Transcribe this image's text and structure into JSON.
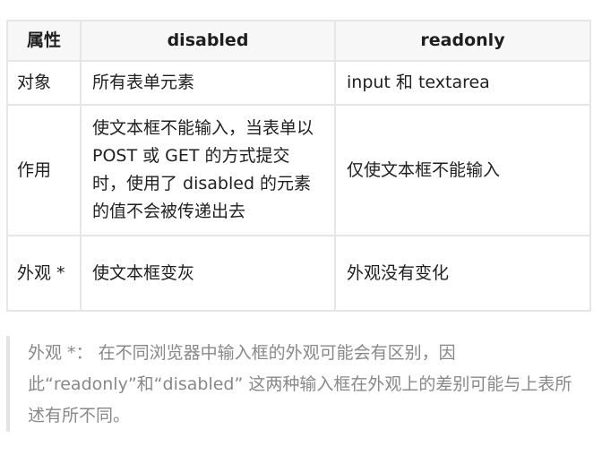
{
  "table": {
    "headers": [
      "属性",
      "disabled",
      "readonly"
    ],
    "rows": [
      {
        "label": "对象",
        "disabled": "所有表单元素",
        "readonly": "input 和 textarea"
      },
      {
        "label": "作用",
        "disabled": "使文本框不能输入，当表单以 POST 或 GET 的方式提交时，使用了 disabled 的元素的值不会被传递出去",
        "readonly": "仅使文本框不能输入"
      },
      {
        "label": "外观 *",
        "disabled": "使文本框变灰",
        "readonly": "外观没有变化"
      }
    ]
  },
  "note": {
    "text": "外观 *： 在不同浏览器中输入框的外观可能会有区别，因此“readonly”和“disabled” 这两种输入框在外观上的差别可能与上表所述有所不同。"
  }
}
